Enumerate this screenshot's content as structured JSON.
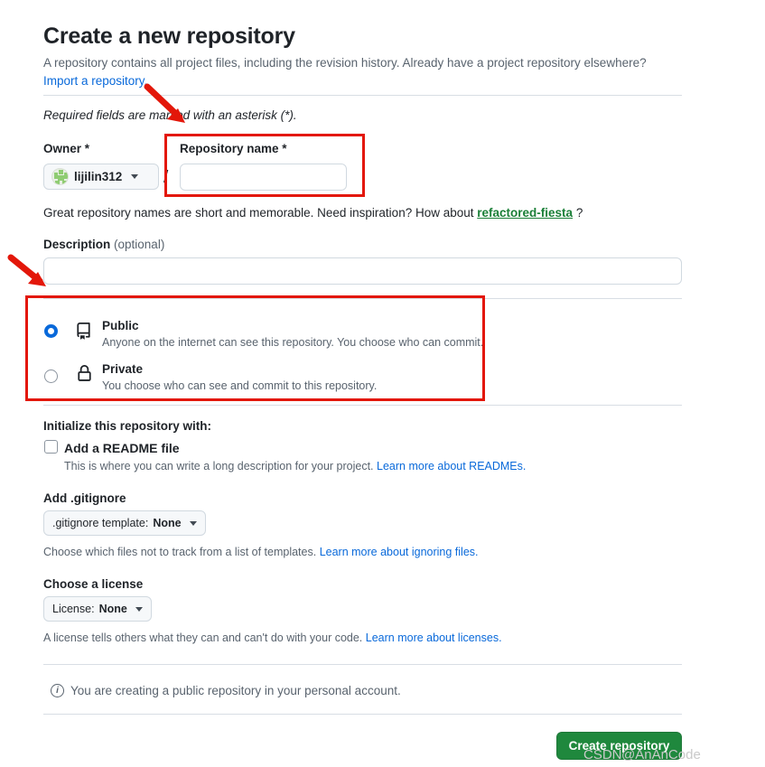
{
  "page": {
    "title": "Create a new repository",
    "subtitle": "A repository contains all project files, including the revision history. Already have a project repository elsewhere?",
    "import_link": "Import a repository.",
    "required_note": "Required fields are marked with an asterisk (*)."
  },
  "owner": {
    "label": "Owner *",
    "value": "lijilin312",
    "separator": "/"
  },
  "repo_name": {
    "label": "Repository name *",
    "value": "",
    "placeholder": "",
    "hint_prefix": "Great repository names are short and memorable. Need inspiration? How about",
    "suggestion": "refactored-fiesta",
    "hint_suffix": "?"
  },
  "description": {
    "label": "Description",
    "optional": "(optional)",
    "value": "",
    "placeholder": ""
  },
  "visibility": {
    "selected": "public",
    "options": [
      {
        "id": "public",
        "name": "Public",
        "icon": "repo-icon",
        "description": "Anyone on the internet can see this repository. You choose who can commit.",
        "checked": true
      },
      {
        "id": "private",
        "name": "Private",
        "icon": "lock-icon",
        "description": "You choose who can see and commit to this repository.",
        "checked": false
      }
    ]
  },
  "initialize": {
    "heading": "Initialize this repository with:",
    "readme": {
      "label": "Add a README file",
      "checked": false,
      "description": "This is where you can write a long description for your project.",
      "link": "Learn more about READMEs."
    }
  },
  "gitignore": {
    "heading": "Add .gitignore",
    "button_prefix": ".gitignore template:",
    "button_value": "None",
    "help": "Choose which files not to track from a list of templates.",
    "link": "Learn more about ignoring files."
  },
  "license": {
    "heading": "Choose a license",
    "button_prefix": "License:",
    "button_value": "None",
    "help": "A license tells others what they can and can't do with your code.",
    "link": "Learn more about licenses."
  },
  "info_note": {
    "icon": "info-icon",
    "text": "You are creating a public repository in your personal account."
  },
  "submit": {
    "label": "Create repository"
  },
  "watermark": {
    "brand": "CSDN",
    "handle": "@AnAnCode"
  },
  "colors": {
    "accent_blue": "#0969DA",
    "green_link": "#1A7F37",
    "button_green": "#1F883D",
    "annotation_red": "#E3170A",
    "muted_text": "#59636E",
    "border": "#d1d9e0"
  }
}
